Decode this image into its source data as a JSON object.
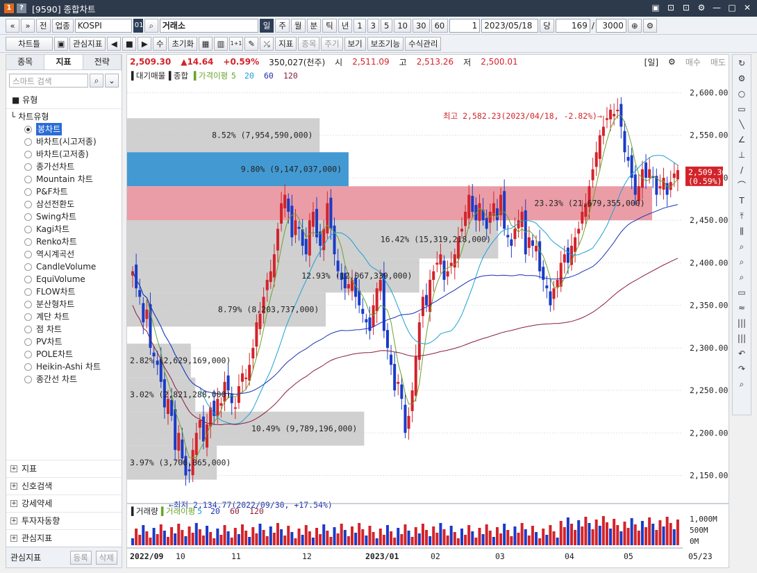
{
  "window": {
    "badge1": "1",
    "badge2": "?",
    "title": "[9590] 종합차트",
    "buttons": [
      "▣",
      "⊡",
      "⊡",
      "⚙",
      "—",
      "□",
      "✕"
    ]
  },
  "toolbar1": {
    "nav": [
      "«",
      "»"
    ],
    "prev_label": "전",
    "type_label": "업종",
    "market_value": "KOSPI",
    "code_value": "01",
    "search_icon": "⌕",
    "name_value": "거래소",
    "periods": [
      "일",
      "주",
      "월",
      "분",
      "틱",
      "년"
    ],
    "intervals": [
      "1",
      "3",
      "5",
      "10",
      "30",
      "60"
    ],
    "count_value": "1",
    "date_value": "2023/05/18",
    "unit_label": "당",
    "num_value": "169",
    "slash": "/",
    "total_value": "3000",
    "zoom_icon": "⊕",
    "settings_icon": "⚙"
  },
  "toolbar2": {
    "buttons": [
      "차트틀",
      "관심지표",
      "초기화",
      "지표",
      "종목",
      "주기",
      "보기",
      "보조기능",
      "수식관리"
    ],
    "misc_icons": [
      "▣",
      "◀",
      "■",
      "▶",
      "수",
      "▦",
      "▥",
      "1+1",
      "✎",
      "⤯"
    ]
  },
  "leftpanel": {
    "tabs": [
      "종목",
      "지표",
      "전략"
    ],
    "search_placeholder": "스마트 검색",
    "search_btns": [
      "⌕",
      "⌄"
    ],
    "category": "유형",
    "node": "차트유형",
    "items": [
      "봉차트",
      "바차트(시고저종)",
      "바차트(고저종)",
      "종가선차트",
      "Mountain 차트",
      "P&F차트",
      "삼선전환도",
      "Swing차트",
      "Kagi차트",
      "Renko차트",
      "역시계곡선",
      "CandleVolume",
      "EquiVolume",
      "FLOW차트",
      "분산형차트",
      "계단 차트",
      "점 차트",
      "PV차트",
      "POLE차트",
      "Heikin-Ashi 차트",
      "종간선 차트"
    ],
    "groups": [
      "지표",
      "신호검색",
      "강세약세",
      "투자자동향",
      "관심지표"
    ],
    "footer_label": "관심지표",
    "footer_buttons": [
      "등록",
      "삭제"
    ]
  },
  "infobar": {
    "price": "2,509.30",
    "change": "▲14.64",
    "pct": "+0.59%",
    "volume": "350,027(천주)",
    "open_label": "시",
    "open": "2,511.09",
    "high_label": "고",
    "high": "2,513.26",
    "low_label": "저",
    "low": "2,500.01",
    "period": "[일]",
    "buy": "매수",
    "sell": "매도"
  },
  "legend": {
    "main": [
      "대기매물",
      "종합",
      "가격이평",
      "5",
      "20",
      "60",
      "120"
    ],
    "volume": [
      "거래량",
      "거래이평",
      "5",
      "20",
      "60",
      "120"
    ]
  },
  "chart_data": {
    "type": "candlestick",
    "y_ticks": [
      "2,600.00",
      "2,550.00",
      "2,500.00",
      "2,450.00",
      "2,400.00",
      "2,350.00",
      "2,300.00",
      "2,250.00",
      "2,200.00",
      "2,150.00"
    ],
    "x_ticks": [
      "2022/09",
      "10",
      "11",
      "12",
      "2023/01",
      "02",
      "03",
      "04",
      "05",
      "05/23"
    ],
    "volume_ticks": [
      "1,000M",
      "500M",
      "0M"
    ],
    "ylim": [
      2130,
      2620
    ],
    "last_price": "2,509.30",
    "last_pct": "(0.59%)",
    "max_annotation": "최고 2,582.23(2023/04/18, -2.82%)→",
    "min_annotation": "←최저 2,134.77(2022/09/30, +17.54%)",
    "colors": {
      "up": "#d3232a",
      "down": "#1a3bc8",
      "ma5": "#6aa32b",
      "ma20": "#1aa0d6",
      "ma60": "#1a2fb5",
      "ma120": "#8a1b3c",
      "highlight_blue": "#2f8fce",
      "highlight_red": "#e8929c",
      "band": "#c8c8c8"
    },
    "volume_profile": [
      {
        "label": "3.97% (3,706,865,000)",
        "low": 2130,
        "high": 2170,
        "pct": 3.97
      },
      {
        "label": "10.49% (9,789,196,000)",
        "low": 2170,
        "high": 2210,
        "pct": 10.49
      },
      {
        "label": "3.02% (2,821,288,000)",
        "low": 2210,
        "high": 2250,
        "pct": 3.02
      },
      {
        "label": "2.82% (2,629,169,000)",
        "low": 2250,
        "high": 2290,
        "pct": 2.82
      },
      {
        "label": "8.79% (8,203,737,000)",
        "low": 2290,
        "high": 2330,
        "pct": 8.79
      },
      {
        "label": "12.93% (12,067,339,000)",
        "low": 2330,
        "high": 2370,
        "pct": 12.93
      },
      {
        "label": "16.42% (15,319,218,000)",
        "low": 2370,
        "high": 2410,
        "pct": 16.42
      },
      {
        "label": "23.23% (21,679,355,000)",
        "low": 2410,
        "high": 2450,
        "pct": 23.23
      },
      {
        "label": "23.23% (21,679,355,000)",
        "low": 2450,
        "high": 2490,
        "pct": 23.23
      },
      {
        "label": "9.80% (9,147,037,000)",
        "low": 2490,
        "high": 2530,
        "pct": 9.8
      },
      {
        "label": "8.52% (7,954,590,000)",
        "low": 2530,
        "high": 2570,
        "pct": 8.52
      }
    ],
    "visible_bands": [
      {
        "label": "8.52% (7,954,590,000)",
        "low": 2530,
        "high": 2570,
        "pct": 8.52,
        "style": "gray"
      },
      {
        "label": "9.80% (9,147,037,000)",
        "low": 2490,
        "high": 2530,
        "pct": 9.8,
        "style": "blue"
      },
      {
        "label": "23.23% (21,679,355,000)",
        "low": 2450,
        "high": 2490,
        "pct": 23.23,
        "style": "red"
      },
      {
        "label": "16.42% (15,319,218,000)",
        "low": 2405,
        "high": 2450,
        "pct": 16.42,
        "style": "gray"
      },
      {
        "label": "12.93% (12,067,339,000)",
        "low": 2365,
        "high": 2405,
        "pct": 12.93,
        "style": "gray"
      },
      {
        "label": "8.79% (8,203,737,000)",
        "low": 2325,
        "high": 2365,
        "pct": 8.79,
        "style": "gray"
      },
      {
        "label": "2.82% (2,629,169,000)",
        "low": 2265,
        "high": 2305,
        "pct": 2.82,
        "style": "gray"
      },
      {
        "label": "3.02% (2,821,288,000)",
        "low": 2225,
        "high": 2265,
        "pct": 3.02,
        "style": "gray"
      },
      {
        "label": "10.49% (9,789,196,000)",
        "low": 2185,
        "high": 2225,
        "pct": 10.49,
        "style": "gray"
      },
      {
        "label": "3.97% (3,706,865,000)",
        "low": 2145,
        "high": 2185,
        "pct": 3.97,
        "style": "gray"
      }
    ],
    "closes": [
      2390,
      2370,
      2360,
      2330,
      2345,
      2300,
      2290,
      2280,
      2260,
      2230,
      2240,
      2220,
      2180,
      2200,
      2170,
      2150,
      2155,
      2180,
      2200,
      2215,
      2190,
      2210,
      2230,
      2220,
      2240,
      2235,
      2260,
      2250,
      2235,
      2230,
      2255,
      2270,
      2265,
      2280,
      2300,
      2330,
      2340,
      2360,
      2380,
      2390,
      2410,
      2440,
      2470,
      2480,
      2460,
      2430,
      2450,
      2440,
      2420,
      2410,
      2450,
      2460,
      2430,
      2420,
      2440,
      2470,
      2440,
      2410,
      2390,
      2380,
      2370,
      2375,
      2380,
      2360,
      2350,
      2340,
      2330,
      2320,
      2350,
      2370,
      2380,
      2320,
      2300,
      2280,
      2250,
      2260,
      2240,
      2200,
      2220,
      2250,
      2290,
      2330,
      2360,
      2350,
      2380,
      2390,
      2400,
      2410,
      2380,
      2390,
      2400,
      2410,
      2430,
      2440,
      2460,
      2480,
      2460,
      2450,
      2470,
      2450,
      2440,
      2460,
      2470,
      2450,
      2480,
      2440,
      2430,
      2420,
      2440,
      2450,
      2460,
      2410,
      2430,
      2420,
      2420,
      2390,
      2380,
      2370,
      2350,
      2370,
      2380,
      2400,
      2410,
      2400,
      2420,
      2430,
      2440,
      2460,
      2470,
      2490,
      2510,
      2530,
      2550,
      2560,
      2570,
      2580,
      2575,
      2580,
      2560,
      2530,
      2520,
      2500,
      2480,
      2490,
      2510,
      2500,
      2510,
      2500,
      2480,
      2490,
      2500,
      2480,
      2495,
      2505,
      2509
    ]
  },
  "rightbar": {
    "icons": [
      "↻",
      "⚙",
      "○",
      "▭",
      "╲",
      "∠",
      "⊥",
      "/",
      "⌒",
      "T",
      "⤒",
      "⫼",
      "⌕",
      "⌕",
      "⌕",
      "▭",
      "≈",
      "|||",
      "|||",
      "↶",
      "↷",
      "⌕"
    ]
  }
}
